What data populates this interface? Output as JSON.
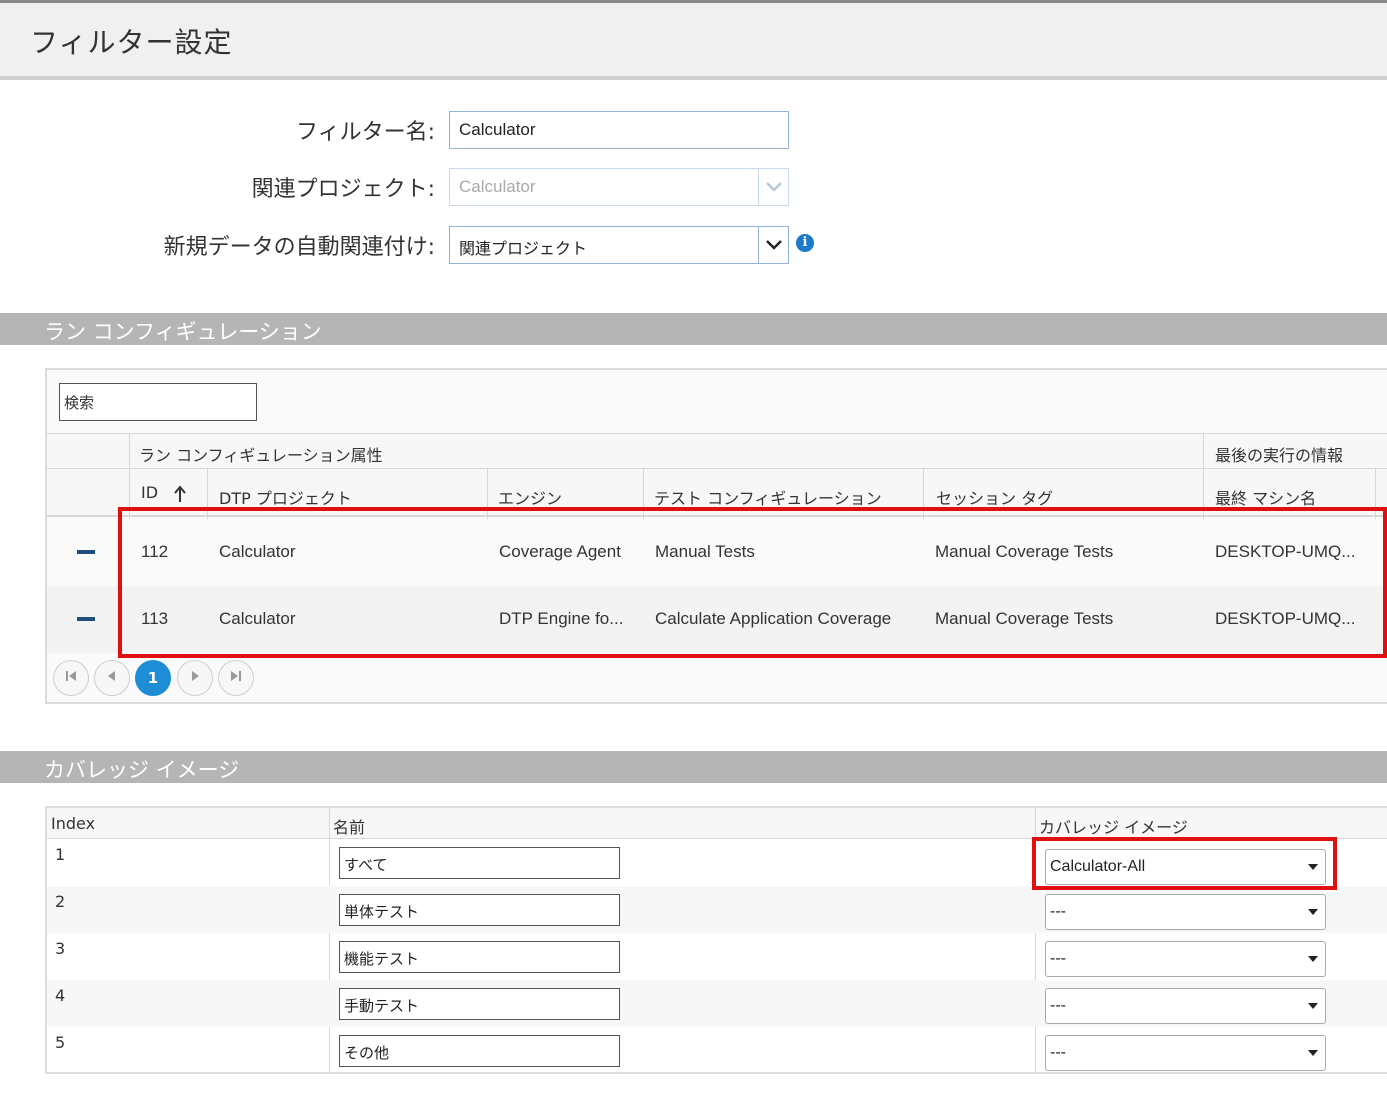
{
  "page": {
    "title": "フィルター設定"
  },
  "form": {
    "filter_name_label": "フィルター名:",
    "filter_name_value": "Calculator",
    "project_label": "関連プロジェクト:",
    "project_value": "Calculator",
    "auto_assoc_label": "新規データの自動関連付け:",
    "auto_assoc_value": "関連プロジェクト"
  },
  "run_config": {
    "section_title": "ラン コンフィギュレーション",
    "search_placeholder": "検索",
    "group_headers": {
      "attributes": "ラン コンフィギュレーション属性",
      "last_run": "最後の実行の情報"
    },
    "columns": [
      "ID",
      "DTP プロジェクト",
      "エンジン",
      "テスト コンフィギュレーション",
      "セッション タグ",
      "最終 マシン名"
    ],
    "rows": [
      {
        "id": "112",
        "project": "Calculator",
        "engine": "Coverage Agent",
        "test_config": "Manual Tests",
        "session_tag": "Manual Coverage Tests",
        "machine": "DESKTOP-UMQ..."
      },
      {
        "id": "113",
        "project": "Calculator",
        "engine": "DTP Engine fo...",
        "test_config": "Calculate Application Coverage",
        "session_tag": "Manual Coverage Tests",
        "machine": "DESKTOP-UMQ..."
      }
    ],
    "pager": {
      "current_page": "1"
    }
  },
  "coverage": {
    "section_title": "カバレッジ イメージ",
    "columns": [
      "Index",
      "名前",
      "カバレッジ イメージ"
    ],
    "rows": [
      {
        "index": "1",
        "name": "すべて",
        "image": "Calculator-All"
      },
      {
        "index": "2",
        "name": "単体テスト",
        "image": "---"
      },
      {
        "index": "3",
        "name": "機能テスト",
        "image": "---"
      },
      {
        "index": "4",
        "name": "手動テスト",
        "image": "---"
      },
      {
        "index": "5",
        "name": "その他",
        "image": "---"
      }
    ]
  },
  "colors": {
    "highlight": "#e01010",
    "accent": "#1d8ed6",
    "section_band": "#b5b5b5"
  }
}
